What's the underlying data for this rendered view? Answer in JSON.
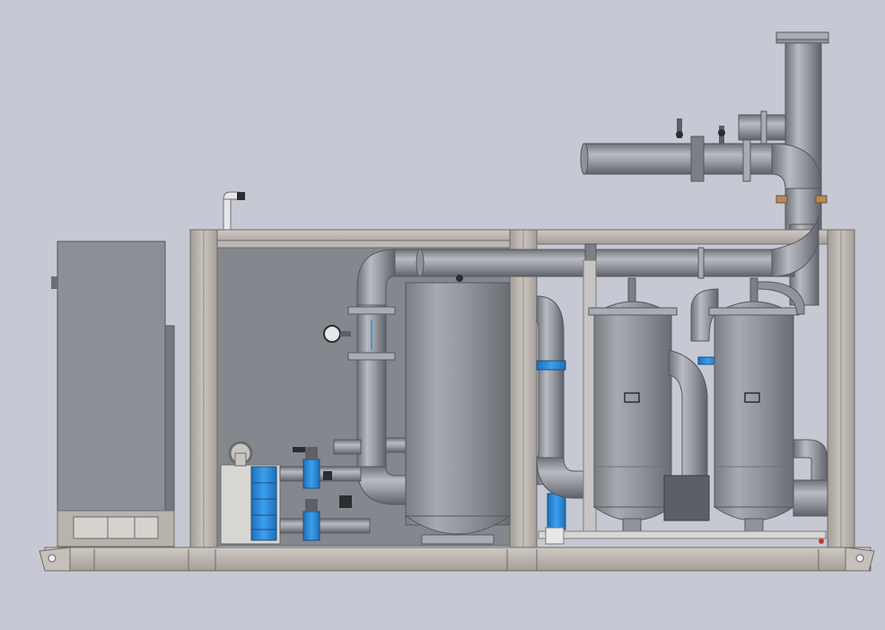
{
  "scene": {
    "background": "#c6c9d3",
    "colors": {
      "steel": "#8f9298",
      "steel_dark": "#5c5f66",
      "steel_light": "#c9cbd0",
      "frame": "#b8b1ab",
      "panel": "#84878d",
      "accent_blue": "#2f8fd8",
      "flange": "#a9acb2",
      "bracket": "#b48a5a"
    },
    "components": [
      "skid-base",
      "control-cabinet",
      "frame",
      "rear-panel",
      "exhaust-stack",
      "header-pipe",
      "buffer-tank",
      "filter-vessel",
      "filter-vessel",
      "plate-heat-exchanger",
      "valve",
      "pressure-gauge"
    ]
  }
}
